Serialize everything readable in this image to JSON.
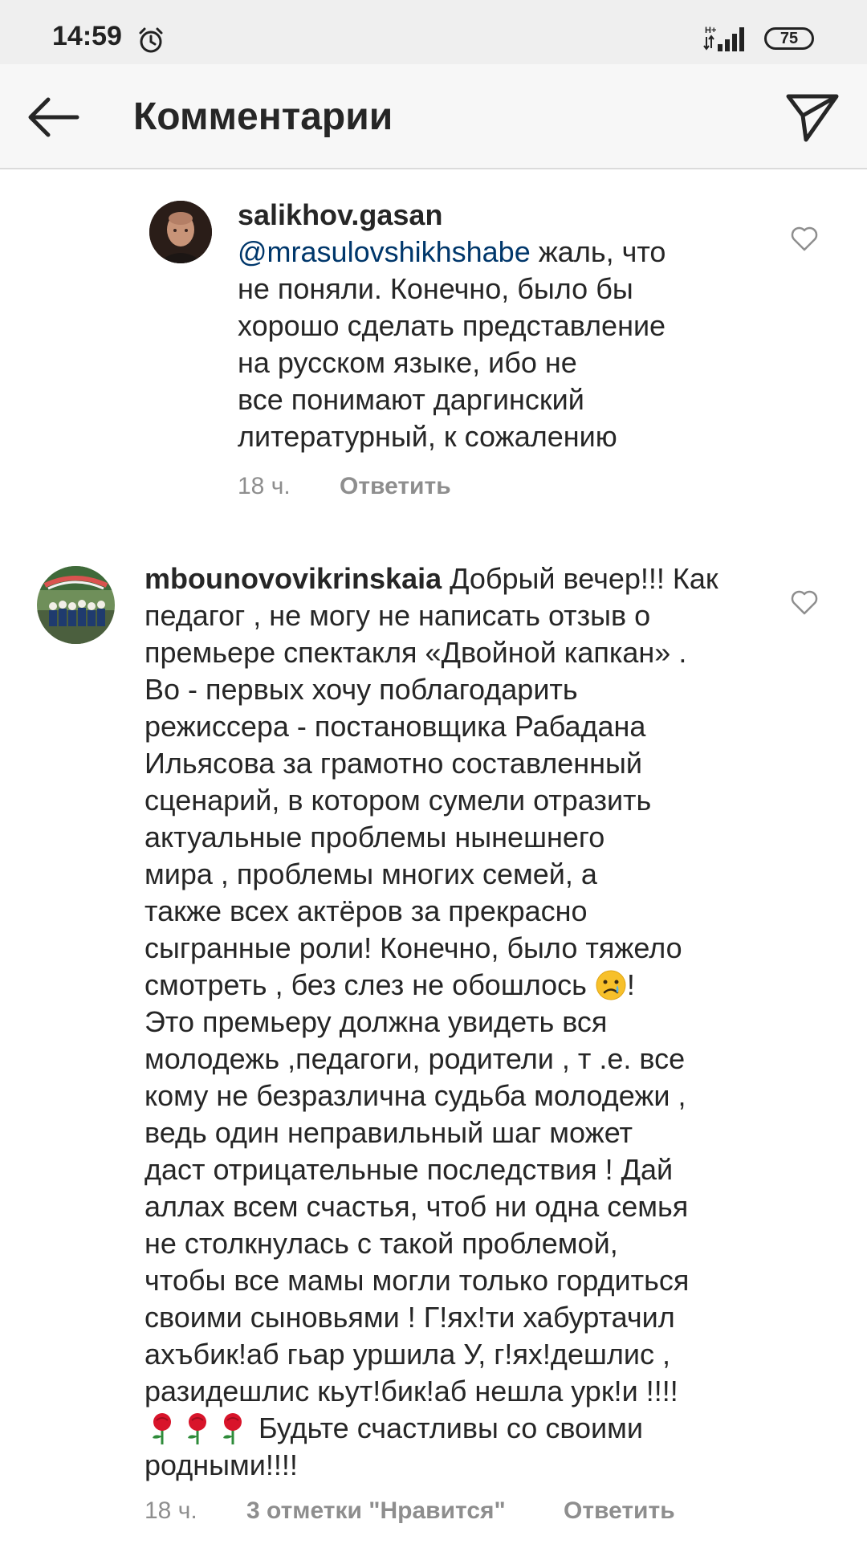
{
  "status_bar": {
    "time": "14:59",
    "network_label": "H+",
    "battery": "75"
  },
  "header": {
    "title": "Комментарии"
  },
  "comments": [
    {
      "username": "salikhov.gasan",
      "mention": "@mrasulovshikhshabe",
      "text_lines": [
        " жаль, что",
        "не поняли. Конечно, было бы",
        "хорошо сделать представление",
        "на русском языке, ибо не",
        "все понимают даргинский",
        "литературный, к сожалению"
      ],
      "time": "18 ч.",
      "reply_label": "Ответить"
    },
    {
      "username": "mbounovovikrinskaia",
      "text_lines": [
        " Добрый вечер!!! Как",
        "педагог , не могу не написать отзыв о",
        "премьере спектакля «Двойной капкан» .",
        "Во - первых хочу поблагодарить",
        "режиссера - постановщика Рабадана",
        "Ильясова  за грамотно составленный",
        "сценарий, в котором сумели отразить",
        "актуальные проблемы нынешнего",
        "мира , проблемы многих семей, а",
        "также всех актёров за прекрасно",
        "сыгранные роли! Конечно, было тяжело",
        "смотреть , без слез не обошлось ",
        "Это премьеру должна увидеть вся",
        "молодежь ,педагоги, родители , т .е. все",
        "кому не безразлична судьба молодежи ,",
        "ведь один неправильный шаг может",
        "даст отрицательные последствия !  Дай",
        "аллах всем счастья, чтоб ни одна семья",
        "не столкнулась с такой проблемой,",
        "чтобы все мамы могли только гордиться",
        "своими сыновьями ! Г!ях!ти хабуртачил",
        "ахъбик!аб гьар уршила У,  г!ях!дешлис ,",
        "разидешлис кьут!бик!аб нешла урк!и !!!!",
        " Будьте счастливы со своими",
        "родными!!!!"
      ],
      "line12_suffix": "!",
      "time": "18 ч.",
      "likes_label": "3 отметки \"Нравится\"",
      "reply_label": "Ответить"
    }
  ],
  "icons": {
    "back": "arrow-left-icon",
    "send": "paper-plane-icon",
    "like": "heart-outline-icon",
    "alarm": "alarm-clock-icon",
    "sad_emoji": "sad-face-emoji",
    "rose": "rose-emoji"
  },
  "colors": {
    "text": "#262626",
    "mention": "#00376b",
    "meta": "#8e8e8e",
    "header_bg": "#f7f7f7",
    "status_bg": "#efefef"
  }
}
